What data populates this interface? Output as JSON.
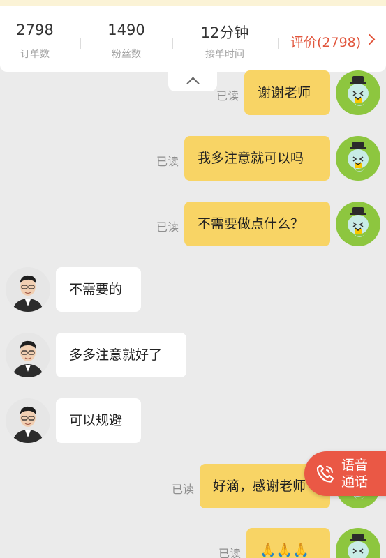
{
  "stats": {
    "orders": {
      "value": "2798",
      "label": "订单数"
    },
    "fans": {
      "value": "1490",
      "label": "粉丝数"
    },
    "response_time": {
      "value": "12分钟",
      "label": "接单时间"
    }
  },
  "rating_link": "评价(2798)",
  "messages": [
    {
      "side": "out",
      "text": "谢谢老师",
      "status": "已读"
    },
    {
      "side": "out",
      "text": "我多注意就可以吗",
      "status": "已读"
    },
    {
      "side": "out",
      "text": "不需要做点什么？",
      "status": "已读"
    },
    {
      "side": "in",
      "text": "不需要的"
    },
    {
      "side": "in",
      "text": "多多注意就好了"
    },
    {
      "side": "in",
      "text": "可以规避"
    },
    {
      "side": "out",
      "text": "好滴，感谢老师",
      "status": "已读"
    },
    {
      "side": "out",
      "text": "🙏🙏🙏",
      "status": "已读"
    }
  ],
  "call_button": {
    "line1": "语音",
    "line2": "通话"
  },
  "colors": {
    "accent": "#e1563d",
    "bubble_out": "#f8d465",
    "call_button": "#ea5845"
  }
}
